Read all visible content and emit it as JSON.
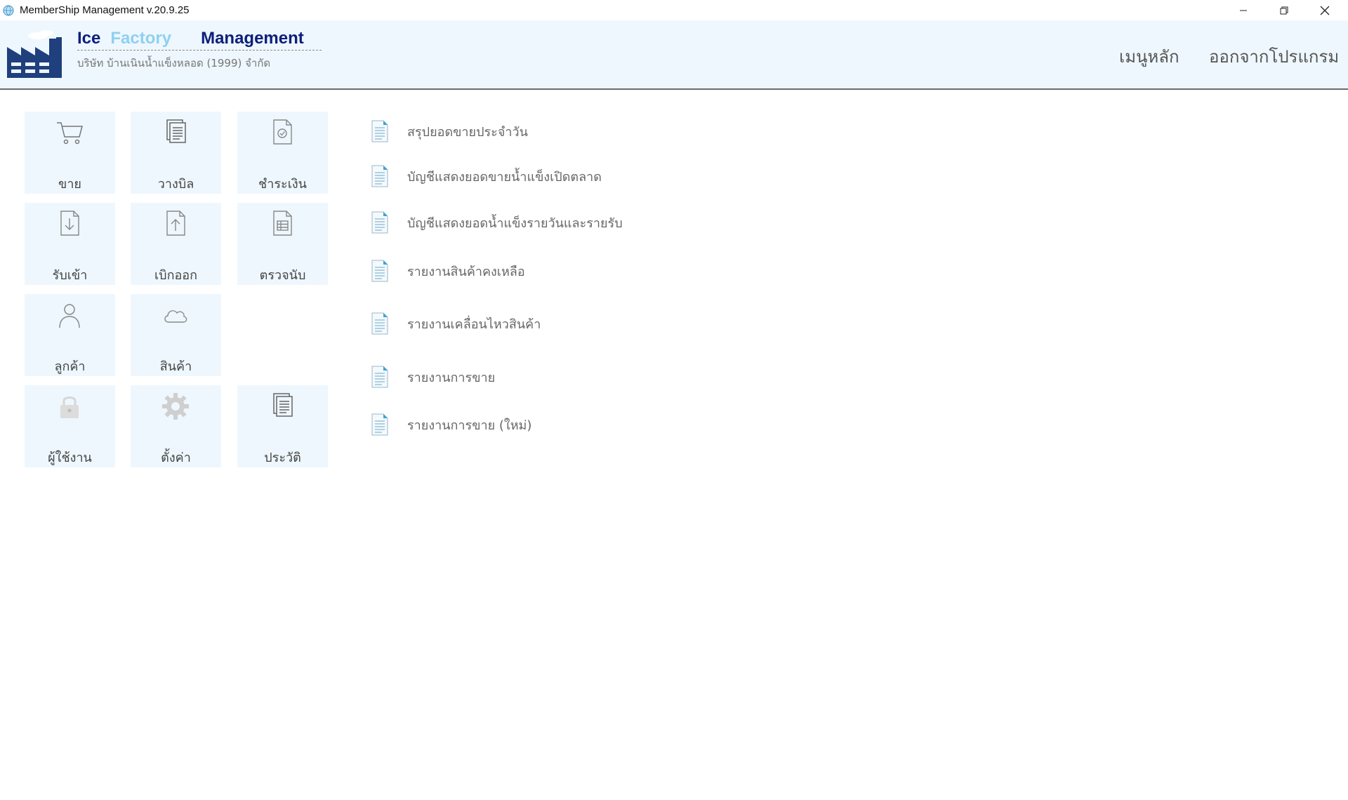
{
  "window": {
    "title": "MemberShip Management v.20.9.25"
  },
  "header": {
    "brand_ice": "Ice",
    "brand_factory": "Factory",
    "brand_management": "Management",
    "company_name": "บริษัท บ้านเนินน้ำแข็งหลอด (1999) จำกัด",
    "nav_main_menu": "เมนูหลัก",
    "nav_exit": "ออกจากโปรแกรม"
  },
  "tiles": [
    {
      "label": "ขาย",
      "icon": "cart-icon"
    },
    {
      "label": "วางบิล",
      "icon": "documents-icon"
    },
    {
      "label": "ชำระเงิน",
      "icon": "check-document-icon"
    },
    {
      "label": "รับเข้า",
      "icon": "download-document-icon"
    },
    {
      "label": "เบิกออก",
      "icon": "upload-document-icon"
    },
    {
      "label": "ตรวจนับ",
      "icon": "table-document-icon"
    },
    {
      "label": "ลูกค้า",
      "icon": "person-icon"
    },
    {
      "label": "สินค้า",
      "icon": "cloud-icon"
    },
    {
      "label": "ผู้ใช้งาน",
      "icon": "lock-icon"
    },
    {
      "label": "ตั้งค่า",
      "icon": "gear-icon"
    },
    {
      "label": "ประวัติ",
      "icon": "history-documents-icon"
    }
  ],
  "reports": [
    {
      "label": "สรุปยอดขายประจำวัน"
    },
    {
      "label": "บัญชีแสดงยอดขายน้ำแข็งเปิดตลาด"
    },
    {
      "label": "บัญชีแสดงยอดน้ำแข็งรายวันและรายรับ"
    },
    {
      "label": "รายงานสินค้าคงเหลือ"
    },
    {
      "label": "รายงานเคลื่อนไหวสินค้า"
    },
    {
      "label": "รายงานการขาย"
    },
    {
      "label": "รายงานการขาย (ใหม่)"
    }
  ]
}
